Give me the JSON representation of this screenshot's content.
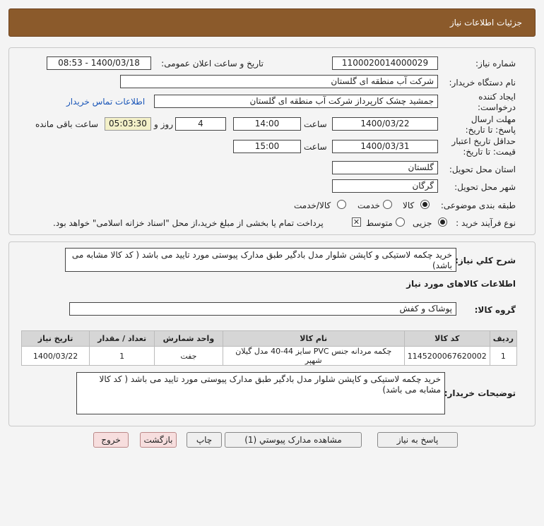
{
  "header": {
    "title": "جزئیات اطلاعات نیاز"
  },
  "form": {
    "need_number_label": "شماره نیاز:",
    "need_number": "1100020014000029",
    "announce_label": "تاریخ و ساعت اعلان عمومی:",
    "announce_value": "1400/03/18 - 08:53",
    "buyer_org_label": "نام دستگاه خریدار:",
    "buyer_org": "شرکت آب منطقه ای گلستان",
    "creator_label": "ایجاد کننده درخواست:",
    "creator": "جمشید چشک کارپرداز شرکت آب منطقه ای گلستان",
    "contact_link": "اطلاعات تماس خریدار",
    "deadline_label": "مهلت ارسال پاسخ: تا تاریخ:",
    "deadline_date": "1400/03/22",
    "time_label": "ساعت",
    "deadline_time": "14:00",
    "days_value": "4",
    "days_label": "روز و",
    "remaining_time": "05:03:30",
    "remaining_label": "ساعت باقی مانده",
    "validity_label": "حداقل تاریخ اعتبار قیمت: تا تاریخ:",
    "validity_date": "1400/03/31",
    "validity_time": "15:00",
    "province_label": "استان محل تحویل:",
    "province": "گلستان",
    "city_label": "شهر محل تحویل:",
    "city": "گرگان",
    "category_label": "طبقه بندی موضوعی:",
    "category_options": [
      "کالا",
      "خدمت",
      "کالا/خدمت"
    ],
    "process_label": "نوع فرآیند خرید :",
    "process_options": [
      "جزیی",
      "متوسط"
    ],
    "payment_note": "پرداخت تمام یا بخشی از مبلغ خرید،از محل \"اسناد خزانه اسلامی\" خواهد بود."
  },
  "need": {
    "desc_label": "شرح کلي نياز:",
    "desc": "خرید چکمه لاستیکی و کاپشن شلوار مدل بادگیر طبق مدارک پیوستی مورد تایید می باشد ( کد کالا مشابه می باشد)",
    "items_title": "اطلاعات کالاهای مورد نیاز",
    "group_label": "گروه کالا:",
    "group": "پوشاک و کفش",
    "table_headers": [
      "ردیف",
      "کد کالا",
      "نام کالا",
      "واحد شمارش",
      "تعداد / مقدار",
      "تاریخ نیاز"
    ],
    "rows": [
      [
        "1",
        "1145200067620002",
        "چکمه مردانه جنس PVC سایز 44-40 مدل گیلان شهپر",
        "جفت",
        "1",
        "1400/03/22"
      ]
    ],
    "buyer_notes_label": "توضیحات خریدار:",
    "buyer_notes": "خرید چکمه لاستیکی و کاپشن شلوار مدل بادگیر طبق مدارک پیوستی مورد تایید می باشد ( کد کالا مشابه می باشد)"
  },
  "buttons": {
    "reply": "پاسخ به نیاز",
    "attachments": "مشاهده مدارک پیوستي (1)",
    "print": "چاپ",
    "back": "بازگشت",
    "exit": "خروج"
  }
}
